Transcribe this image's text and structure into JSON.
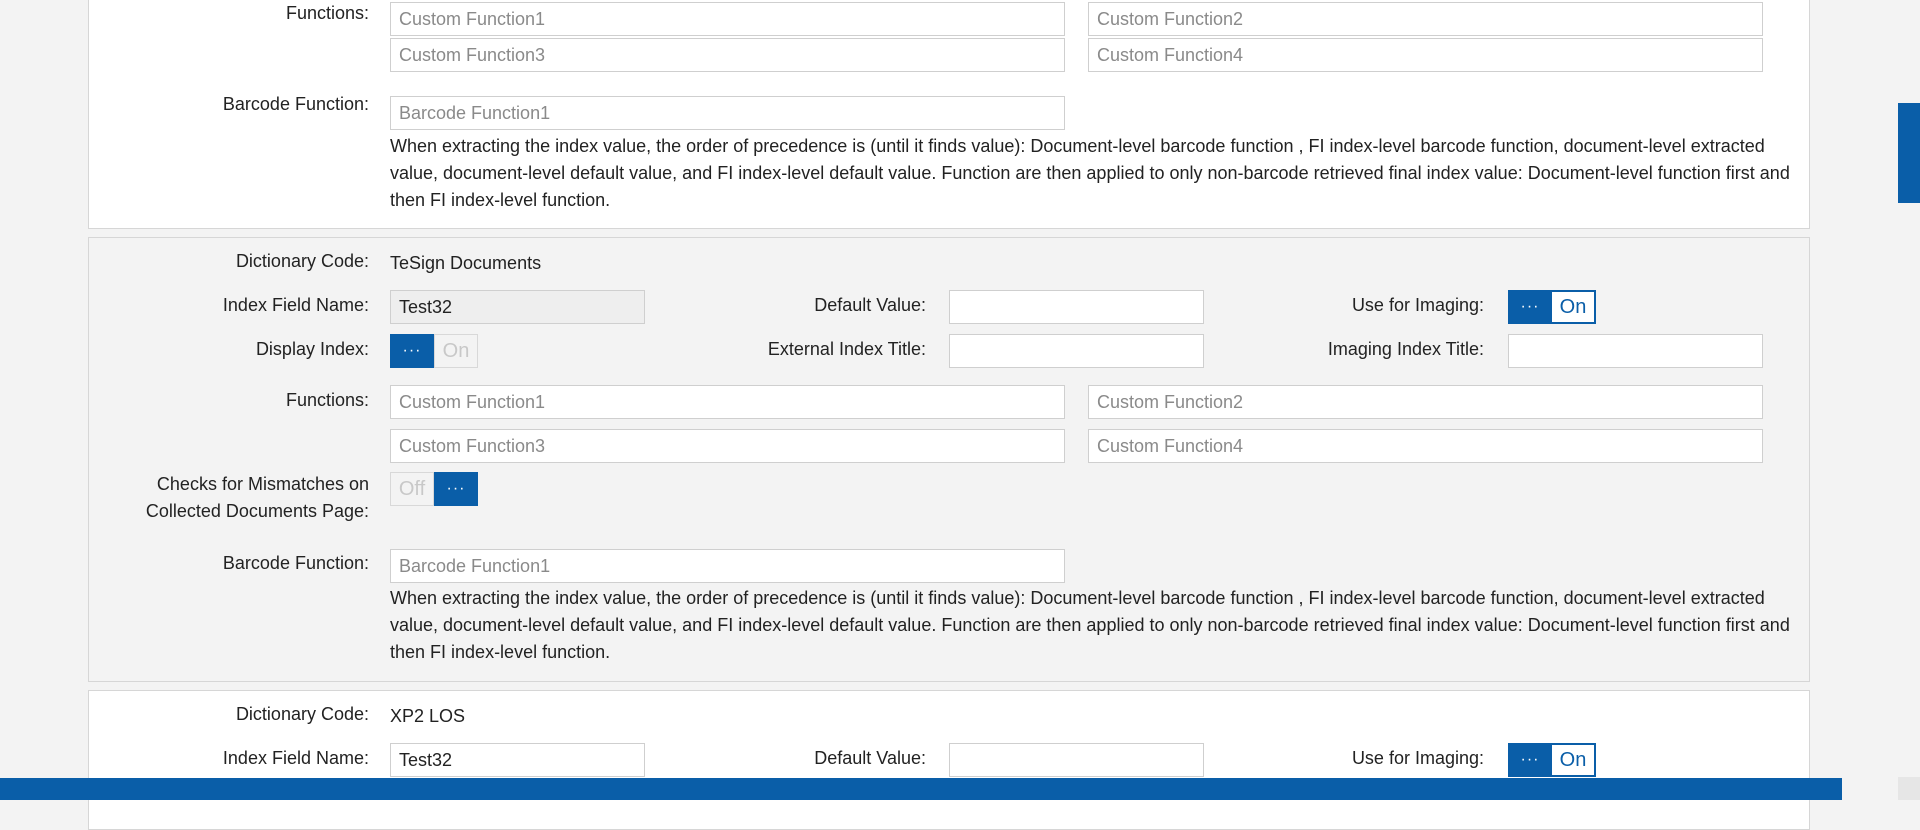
{
  "sections": [
    {
      "functions_label": "Functions:",
      "functions": [
        "Custom Function1",
        "Custom Function2",
        "Custom Function3",
        "Custom Function4"
      ],
      "barcode_label": "Barcode Function:",
      "barcode_placeholder": "Barcode Function1",
      "note": "When extracting the index value, the order of precedence is (until it finds value): Document-level barcode function , FI index-level barcode function, document-level extracted value, document-level default value, and FI index-level default value. Function are then applied to only non-barcode retrieved final index value: Document-level function first and then FI index-level function."
    },
    {
      "dictionary_label": "Dictionary Code:",
      "dictionary_value": "TeSign Documents",
      "index_field_label": "Index Field Name:",
      "index_field_value": "Test32",
      "default_value_label": "Default Value:",
      "default_value": "",
      "use_imaging_label": "Use for Imaging:",
      "use_imaging_state": "On",
      "display_index_label": "Display Index:",
      "display_index_state": "On",
      "external_title_label": "External Index Title:",
      "external_title_value": "",
      "imaging_title_label": "Imaging Index Title:",
      "imaging_title_value": "",
      "functions_label": "Functions:",
      "functions": [
        "Custom Function1",
        "Custom Function2",
        "Custom Function3",
        "Custom Function4"
      ],
      "mismatch_label": "Checks for Mismatches on Collected Documents Page:",
      "mismatch_state": "Off",
      "barcode_label": "Barcode Function:",
      "barcode_placeholder": "Barcode Function1",
      "note": "When extracting the index value, the order of precedence is (until it finds value): Document-level barcode function , FI index-level barcode function, document-level extracted value, document-level default value, and FI index-level default value. Function are then applied to only non-barcode retrieved final index value: Document-level function first and then FI index-level function."
    },
    {
      "dictionary_label": "Dictionary Code:",
      "dictionary_value": "XP2 LOS",
      "index_field_label": "Index Field Name:",
      "index_field_value": "Test32",
      "default_value_label": "Default Value:",
      "default_value": "",
      "use_imaging_label": "Use for Imaging:",
      "use_imaging_state": "On"
    }
  ],
  "toggle_knob_glyph": "···",
  "colors": {
    "accent": "#0a5ea8",
    "panel_gray": "#f3f3f3",
    "panel_white": "#ffffff"
  }
}
